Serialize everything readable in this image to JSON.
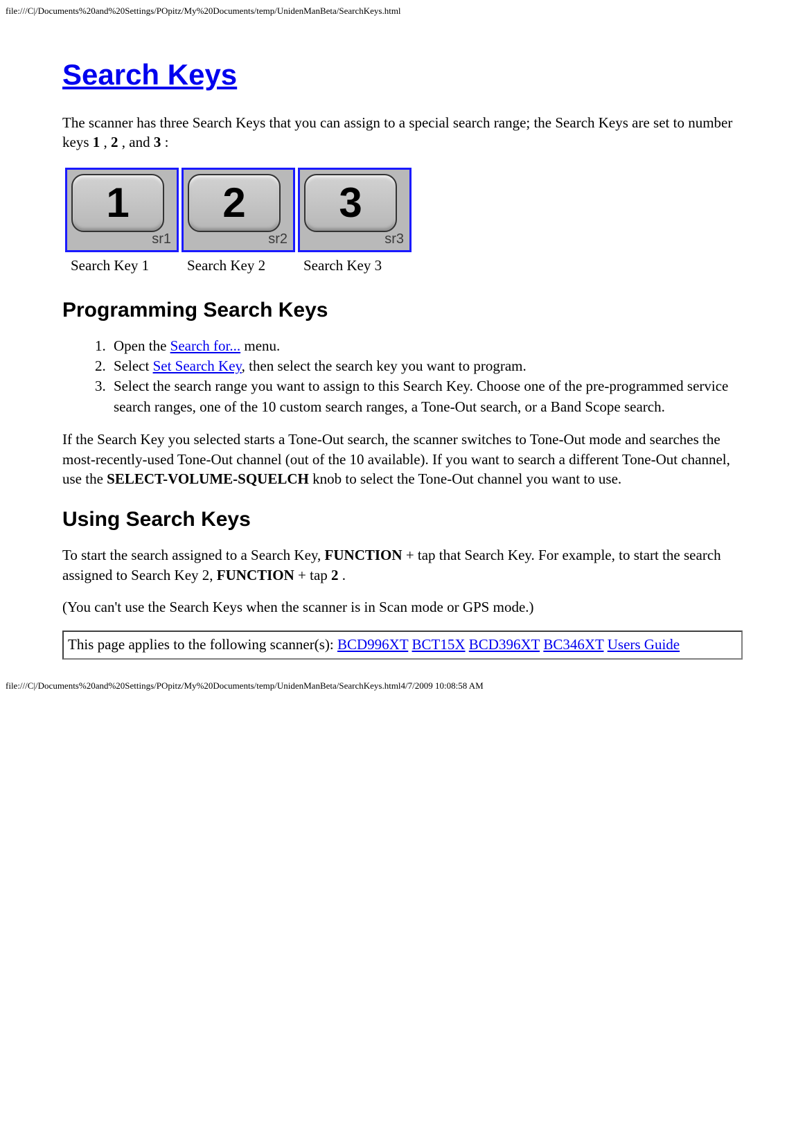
{
  "pathTop": "file:///C|/Documents%20and%20Settings/POpitz/My%20Documents/temp/UnidenManBeta/SearchKeys.html",
  "pathBottom": "file:///C|/Documents%20and%20Settings/POpitz/My%20Documents/temp/UnidenManBeta/SearchKeys.html4/7/2009 10:08:58 AM",
  "title": "Search Keys",
  "intro": {
    "t1": "The scanner has three Search Keys that you can assign to a special search range; the Search Keys are set to number keys ",
    "b1": "1",
    "t2": " , ",
    "b2": "2",
    "t3": " , and ",
    "b3": "3",
    "t4": " :"
  },
  "keys": [
    {
      "num": "1",
      "srLabel": "sr1",
      "caption": "Search Key 1"
    },
    {
      "num": "2",
      "srLabel": "sr2",
      "caption": "Search Key 2"
    },
    {
      "num": "3",
      "srLabel": "sr3",
      "caption": "Search Key 3"
    }
  ],
  "h2a": "Programming Search Keys",
  "steps": {
    "s1a": "Open the ",
    "s1link": "Search for...",
    "s1b": " menu.",
    "s2a": "Select ",
    "s2link": "Set Search Key",
    "s2b": ", then select the search key you want to program.",
    "s3": "Select the search range you want to assign to this Search Key. Choose one of the pre-programmed service search ranges, one of the 10 custom search ranges, a Tone-Out search, or a Band Scope search."
  },
  "toneOut": {
    "t1": "If the Search Key you selected starts a Tone-Out search, the scanner switches to Tone-Out mode and searches the most-recently-used Tone-Out channel (out of the 10 available). If you want to search a different Tone-Out channel, use the ",
    "b1": "SELECT-VOLUME-SQUELCH",
    "t2": " knob to select the Tone-Out channel you want to use."
  },
  "h2b": "Using Search Keys",
  "using": {
    "t1": "To start the search assigned to a Search Key, ",
    "b1": "FUNCTION",
    "t2": " + tap that Search Key. For example, to start the search assigned to Search Key 2, ",
    "b2": "FUNCTION",
    "t3": " + tap ",
    "b3": "2",
    "t4": " ."
  },
  "note": "(You can't use the Search Keys when the scanner is in Scan mode or GPS mode.)",
  "applies": {
    "prefix": "This page applies to the following scanner(s): ",
    "links": [
      "BCD996XT",
      "BCT15X",
      "BCD396XT",
      "BC346XT",
      "Users Guide"
    ]
  }
}
